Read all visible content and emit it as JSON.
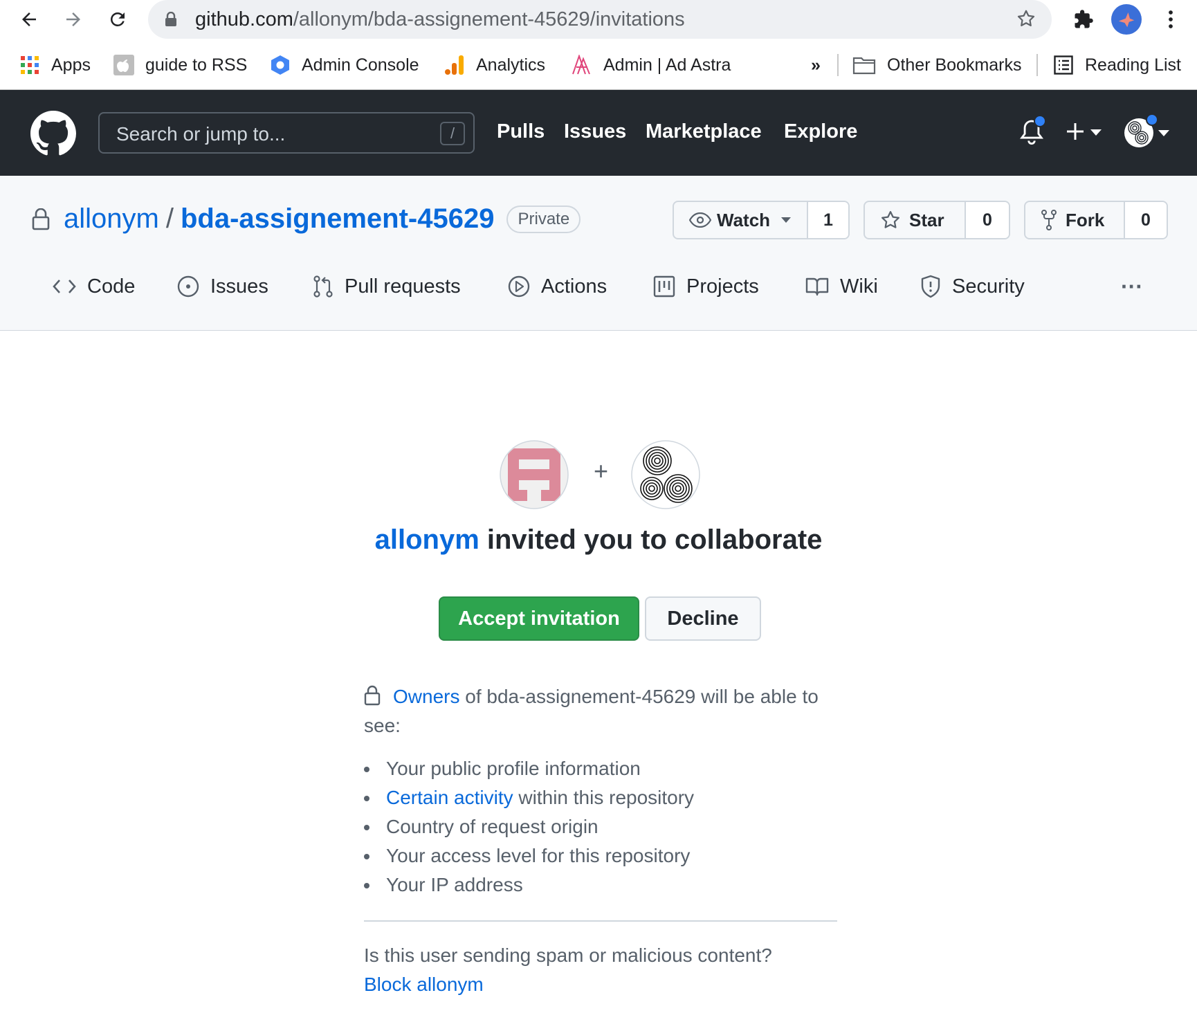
{
  "browser": {
    "url_host": "github.com",
    "url_path": "/allonym/bda-assignement-45629/invitations",
    "bookmarks": [
      {
        "label": "Apps",
        "icon": "apps-grid-icon"
      },
      {
        "label": "guide to RSS",
        "icon": "apple-icon"
      },
      {
        "label": "Admin Console",
        "icon": "hexagon-icon"
      },
      {
        "label": "Analytics",
        "icon": "analytics-icon"
      },
      {
        "label": "Admin | Ad Astra",
        "icon": "ad-astra-icon"
      }
    ],
    "overflow_label": "»",
    "other_bookmarks": "Other Bookmarks",
    "reading_list": "Reading List"
  },
  "github_header": {
    "search_placeholder": "Search or jump to...",
    "search_shortcut": "/",
    "nav": [
      "Pulls",
      "Issues",
      "Marketplace",
      "Explore"
    ],
    "plus_label": "+"
  },
  "repo": {
    "owner": "allonym",
    "separator": "/",
    "name": "bda-assignement-45629",
    "visibility": "Private",
    "watch": {
      "label": "Watch",
      "count": "1"
    },
    "star": {
      "label": "Star",
      "count": "0"
    },
    "fork": {
      "label": "Fork",
      "count": "0"
    },
    "tabs": [
      {
        "label": "Code",
        "icon": "code-icon"
      },
      {
        "label": "Issues",
        "icon": "issue-icon"
      },
      {
        "label": "Pull requests",
        "icon": "pull-request-icon"
      },
      {
        "label": "Actions",
        "icon": "play-icon"
      },
      {
        "label": "Projects",
        "icon": "project-icon"
      },
      {
        "label": "Wiki",
        "icon": "book-icon"
      },
      {
        "label": "Security",
        "icon": "shield-icon"
      }
    ],
    "more_label": "···"
  },
  "invitation": {
    "plus": "+",
    "inviter": "allonym",
    "title_rest": " invited you to collaborate",
    "accept_label": "Accept invitation",
    "decline_label": "Decline",
    "owners_link": "Owners",
    "owners_text": " of bda-assignement-45629 will be able to see:",
    "visible_items": [
      {
        "link": "",
        "text": "Your public profile information"
      },
      {
        "link": "Certain activity",
        "text": " within this repository"
      },
      {
        "link": "",
        "text": "Country of request origin"
      },
      {
        "link": "",
        "text": "Your access level for this repository"
      },
      {
        "link": "",
        "text": "Your IP address"
      }
    ],
    "spam_question": "Is this user sending spam or malicious content?",
    "block_link": "Block allonym"
  },
  "colors": {
    "link": "#0969da",
    "accept": "#2da44e",
    "header_bg": "#24292f",
    "notification_dot": "#2f81f7"
  }
}
